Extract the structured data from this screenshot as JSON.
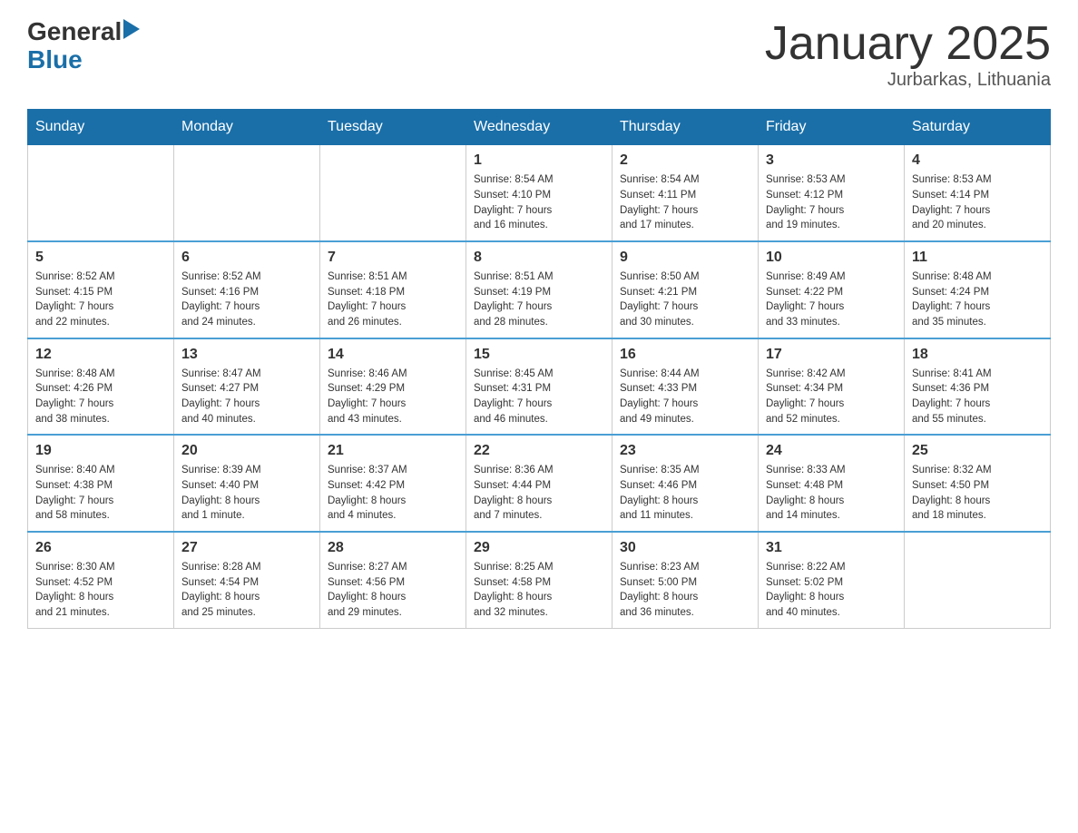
{
  "logo": {
    "text_general": "General",
    "triangle": "▶",
    "text_blue": "Blue"
  },
  "header": {
    "month_title": "January 2025",
    "location": "Jurbarkas, Lithuania"
  },
  "days_of_week": [
    "Sunday",
    "Monday",
    "Tuesday",
    "Wednesday",
    "Thursday",
    "Friday",
    "Saturday"
  ],
  "weeks": [
    [
      {
        "num": "",
        "info": ""
      },
      {
        "num": "",
        "info": ""
      },
      {
        "num": "",
        "info": ""
      },
      {
        "num": "1",
        "info": "Sunrise: 8:54 AM\nSunset: 4:10 PM\nDaylight: 7 hours\nand 16 minutes."
      },
      {
        "num": "2",
        "info": "Sunrise: 8:54 AM\nSunset: 4:11 PM\nDaylight: 7 hours\nand 17 minutes."
      },
      {
        "num": "3",
        "info": "Sunrise: 8:53 AM\nSunset: 4:12 PM\nDaylight: 7 hours\nand 19 minutes."
      },
      {
        "num": "4",
        "info": "Sunrise: 8:53 AM\nSunset: 4:14 PM\nDaylight: 7 hours\nand 20 minutes."
      }
    ],
    [
      {
        "num": "5",
        "info": "Sunrise: 8:52 AM\nSunset: 4:15 PM\nDaylight: 7 hours\nand 22 minutes."
      },
      {
        "num": "6",
        "info": "Sunrise: 8:52 AM\nSunset: 4:16 PM\nDaylight: 7 hours\nand 24 minutes."
      },
      {
        "num": "7",
        "info": "Sunrise: 8:51 AM\nSunset: 4:18 PM\nDaylight: 7 hours\nand 26 minutes."
      },
      {
        "num": "8",
        "info": "Sunrise: 8:51 AM\nSunset: 4:19 PM\nDaylight: 7 hours\nand 28 minutes."
      },
      {
        "num": "9",
        "info": "Sunrise: 8:50 AM\nSunset: 4:21 PM\nDaylight: 7 hours\nand 30 minutes."
      },
      {
        "num": "10",
        "info": "Sunrise: 8:49 AM\nSunset: 4:22 PM\nDaylight: 7 hours\nand 33 minutes."
      },
      {
        "num": "11",
        "info": "Sunrise: 8:48 AM\nSunset: 4:24 PM\nDaylight: 7 hours\nand 35 minutes."
      }
    ],
    [
      {
        "num": "12",
        "info": "Sunrise: 8:48 AM\nSunset: 4:26 PM\nDaylight: 7 hours\nand 38 minutes."
      },
      {
        "num": "13",
        "info": "Sunrise: 8:47 AM\nSunset: 4:27 PM\nDaylight: 7 hours\nand 40 minutes."
      },
      {
        "num": "14",
        "info": "Sunrise: 8:46 AM\nSunset: 4:29 PM\nDaylight: 7 hours\nand 43 minutes."
      },
      {
        "num": "15",
        "info": "Sunrise: 8:45 AM\nSunset: 4:31 PM\nDaylight: 7 hours\nand 46 minutes."
      },
      {
        "num": "16",
        "info": "Sunrise: 8:44 AM\nSunset: 4:33 PM\nDaylight: 7 hours\nand 49 minutes."
      },
      {
        "num": "17",
        "info": "Sunrise: 8:42 AM\nSunset: 4:34 PM\nDaylight: 7 hours\nand 52 minutes."
      },
      {
        "num": "18",
        "info": "Sunrise: 8:41 AM\nSunset: 4:36 PM\nDaylight: 7 hours\nand 55 minutes."
      }
    ],
    [
      {
        "num": "19",
        "info": "Sunrise: 8:40 AM\nSunset: 4:38 PM\nDaylight: 7 hours\nand 58 minutes."
      },
      {
        "num": "20",
        "info": "Sunrise: 8:39 AM\nSunset: 4:40 PM\nDaylight: 8 hours\nand 1 minute."
      },
      {
        "num": "21",
        "info": "Sunrise: 8:37 AM\nSunset: 4:42 PM\nDaylight: 8 hours\nand 4 minutes."
      },
      {
        "num": "22",
        "info": "Sunrise: 8:36 AM\nSunset: 4:44 PM\nDaylight: 8 hours\nand 7 minutes."
      },
      {
        "num": "23",
        "info": "Sunrise: 8:35 AM\nSunset: 4:46 PM\nDaylight: 8 hours\nand 11 minutes."
      },
      {
        "num": "24",
        "info": "Sunrise: 8:33 AM\nSunset: 4:48 PM\nDaylight: 8 hours\nand 14 minutes."
      },
      {
        "num": "25",
        "info": "Sunrise: 8:32 AM\nSunset: 4:50 PM\nDaylight: 8 hours\nand 18 minutes."
      }
    ],
    [
      {
        "num": "26",
        "info": "Sunrise: 8:30 AM\nSunset: 4:52 PM\nDaylight: 8 hours\nand 21 minutes."
      },
      {
        "num": "27",
        "info": "Sunrise: 8:28 AM\nSunset: 4:54 PM\nDaylight: 8 hours\nand 25 minutes."
      },
      {
        "num": "28",
        "info": "Sunrise: 8:27 AM\nSunset: 4:56 PM\nDaylight: 8 hours\nand 29 minutes."
      },
      {
        "num": "29",
        "info": "Sunrise: 8:25 AM\nSunset: 4:58 PM\nDaylight: 8 hours\nand 32 minutes."
      },
      {
        "num": "30",
        "info": "Sunrise: 8:23 AM\nSunset: 5:00 PM\nDaylight: 8 hours\nand 36 minutes."
      },
      {
        "num": "31",
        "info": "Sunrise: 8:22 AM\nSunset: 5:02 PM\nDaylight: 8 hours\nand 40 minutes."
      },
      {
        "num": "",
        "info": ""
      }
    ]
  ]
}
